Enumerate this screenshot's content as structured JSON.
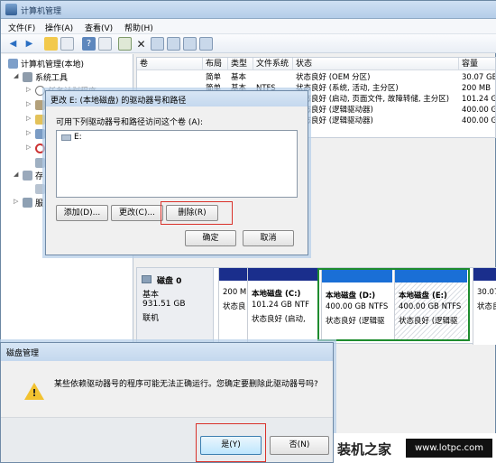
{
  "window": {
    "title": "计算机管理"
  },
  "menu": [
    "文件(F)",
    "操作(A)",
    "查看(V)",
    "帮助(H)"
  ],
  "tree": {
    "root": "计算机管理(本地)",
    "system_tools": "系统工具",
    "task_scheduler": "任务计划程序",
    "storage": "存",
    "services": "服"
  },
  "table": {
    "headers": [
      "卷",
      "布局",
      "类型",
      "文件系统",
      "状态",
      "容量"
    ],
    "rows": [
      {
        "layout": "简单",
        "type": "基本",
        "fs": "",
        "status": "状态良好 (OEM 分区)",
        "size": "30.07 GB"
      },
      {
        "layout": "简单",
        "type": "基本",
        "fs": "NTFS",
        "status": "状态良好 (系统, 活动, 主分区)",
        "size": "200 MB"
      },
      {
        "layout": "",
        "type": "",
        "fs": "",
        "status": "状态良好 (启动, 页面文件, 故障转储, 主分区)",
        "size": "101.24 GB"
      },
      {
        "layout": "",
        "type": "",
        "fs": "",
        "status": "状态良好 (逻辑驱动器)",
        "size": "400.00 GB"
      },
      {
        "layout": "",
        "type": "",
        "fs": "",
        "status": "状态良好 (逻辑驱动器)",
        "size": "400.00 GB"
      }
    ]
  },
  "disk": {
    "name": "磁盘 0",
    "type": "基本",
    "size": "931.51 GB",
    "status": "联机",
    "partitions": [
      {
        "l1": "200 M",
        "l2": "状态良"
      },
      {
        "l1": "本地磁盘 (C:)",
        "l2": "101.24 GB NTF",
        "l3": "状态良好 (启动,"
      },
      {
        "l1": "本地磁盘 (D:)",
        "l2": "400.00 GB NTFS",
        "l3": "状态良好 (逻辑驱"
      },
      {
        "l1": "本地磁盘 (E:)",
        "l2": "400.00 GB NTFS",
        "l3": "状态良好 (逻辑驱"
      },
      {
        "l1": "30.07",
        "l2": "状态良"
      }
    ]
  },
  "drive_dialog": {
    "title": "更改 E: (本地磁盘) 的驱动器号和路径",
    "prompt": "可用下列驱动器号和路径访问这个卷 (A):",
    "list_item": "E:",
    "add": "添加(D)...",
    "change": "更改(C)...",
    "remove": "删除(R)",
    "ok": "确定",
    "cancel": "取消"
  },
  "confirm": {
    "title": "磁盘管理",
    "message": "某些依赖驱动器号的程序可能无法正确运行。您确定要删除此驱动器号吗?",
    "yes": "是(Y)",
    "no": "否(N)"
  },
  "watermark": {
    "site": "装机之家",
    "url": "www.lotpc.com"
  },
  "colors": {
    "primary_part": "#1a2e8c",
    "logical_part": "#1a6fd6",
    "highlight_red": "#d9312a",
    "highlight_green": "#1f8c2f"
  }
}
